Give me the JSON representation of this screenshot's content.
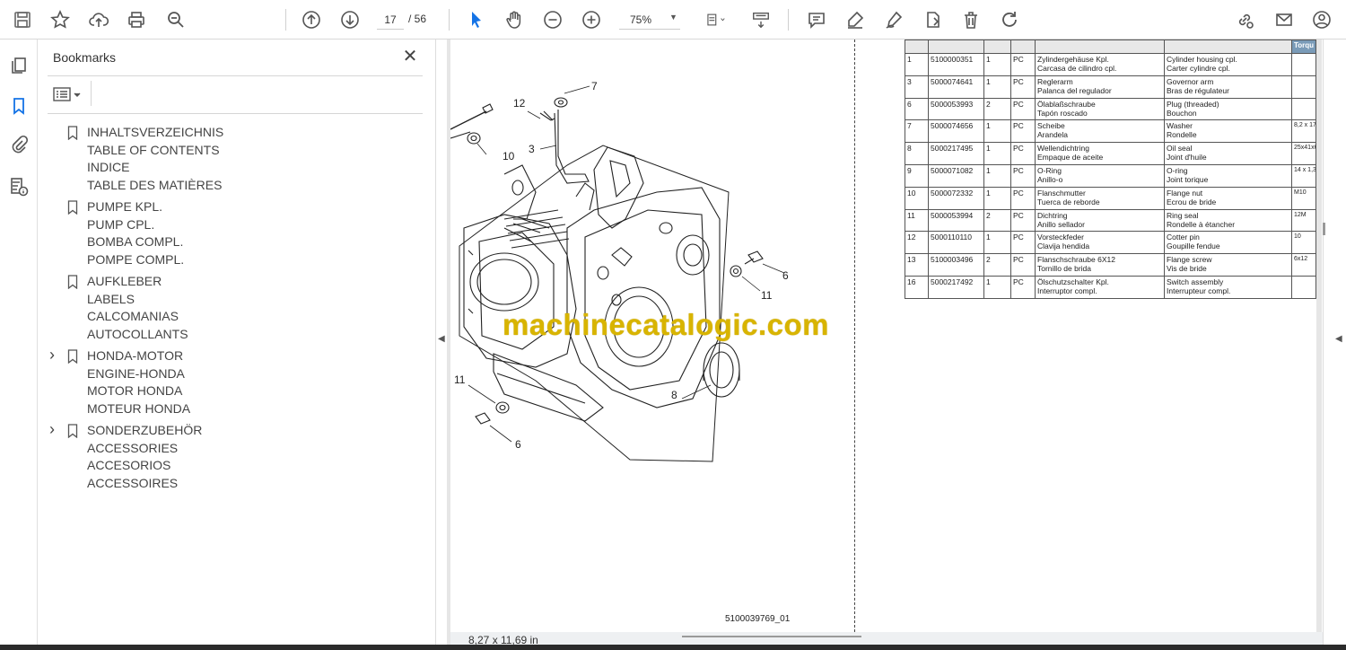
{
  "toolbar": {
    "page_current": "17",
    "page_total": "/ 56",
    "zoom": "75%",
    "icons": [
      "save-icon",
      "star-icon",
      "upload-icon",
      "print-icon",
      "search-zoom-icon",
      "page-up-icon",
      "page-down-icon",
      "zoom-out-icon",
      "zoom-in-icon",
      "select-cursor-icon",
      "hand-icon",
      "fit-page-icon",
      "scroll-mode-icon",
      "comment-icon",
      "highlight-icon",
      "draw-icon",
      "edit-text-icon",
      "delete-icon",
      "rotate-icon",
      "share-link-icon",
      "mail-icon",
      "account-icon"
    ]
  },
  "rail": {
    "icons": [
      "pages-icon",
      "bookmarks-icon",
      "attachments-icon",
      "file-info-icon"
    ]
  },
  "bookmarks": {
    "title": "Bookmarks",
    "entries": [
      {
        "expandable": false,
        "lines": [
          "INHALTSVERZEICHNIS",
          "TABLE OF CONTENTS",
          "INDICE",
          "TABLE DES MATIÈRES"
        ]
      },
      {
        "expandable": false,
        "lines": [
          "PUMPE KPL.",
          "PUMP CPL.",
          "BOMBA COMPL.",
          "POMPE COMPL."
        ]
      },
      {
        "expandable": false,
        "lines": [
          "AUFKLEBER",
          "LABELS",
          "CALCOMANIAS",
          "AUTOCOLLANTS"
        ]
      },
      {
        "expandable": true,
        "lines": [
          "HONDA-MOTOR",
          "ENGINE-HONDA",
          "MOTOR HONDA",
          "MOTEUR HONDA"
        ]
      },
      {
        "expandable": true,
        "lines": [
          "SONDERZUBEHÖR",
          "ACCESSORIES",
          "ACCESORIOS",
          "ACCESSOIRES"
        ]
      }
    ]
  },
  "document": {
    "callouts": [
      "7",
      "12",
      "3",
      "10",
      "6",
      "11",
      "11",
      "8",
      "6"
    ],
    "drawing_code": "5100039769_01",
    "watermark": "machinecatalogic.com",
    "table_header_torque": "Torqu",
    "parts": [
      {
        "pos": "1",
        "number": "5100000351",
        "qty": "1",
        "unit": "PC",
        "de": "Zylindergehäuse Kpl.",
        "es": "Carcasa de cilindro cpl.",
        "en": "Cylinder housing cpl.",
        "fr": "Carter cylindre cpl.",
        "spec": ""
      },
      {
        "pos": "3",
        "number": "5000074641",
        "qty": "1",
        "unit": "PC",
        "de": "Reglerarm",
        "es": "Palanca del regulador",
        "en": "Governor arm",
        "fr": "Bras de régulateur",
        "spec": ""
      },
      {
        "pos": "6",
        "number": "5000053993",
        "qty": "2",
        "unit": "PC",
        "de": "Ölablaßschraube",
        "es": "Tapón roscado",
        "en": "Plug (threaded)",
        "fr": "Bouchon",
        "spec": ""
      },
      {
        "pos": "7",
        "number": "5000074656",
        "qty": "1",
        "unit": "PC",
        "de": "Scheibe",
        "es": "Arandela",
        "en": "Washer",
        "fr": "Rondelle",
        "spec": "8,2 x 17"
      },
      {
        "pos": "8",
        "number": "5000217495",
        "qty": "1",
        "unit": "PC",
        "de": "Wellendichtring",
        "es": "Empaque de aceite",
        "en": "Oil seal",
        "fr": "Joint d'huile",
        "spec": "25x41x6"
      },
      {
        "pos": "9",
        "number": "5000071082",
        "qty": "1",
        "unit": "PC",
        "de": "O-Ring",
        "es": "Anillo-o",
        "en": "O-ring",
        "fr": "Joint torique",
        "spec": "14 x 1,3"
      },
      {
        "pos": "10",
        "number": "5000072332",
        "qty": "1",
        "unit": "PC",
        "de": "Flanschmutter",
        "es": "Tuerca de reborde",
        "en": "Flange nut",
        "fr": "Ecrou de bride",
        "spec": "M10"
      },
      {
        "pos": "11",
        "number": "5000053994",
        "qty": "2",
        "unit": "PC",
        "de": "Dichtring",
        "es": "Anillo sellador",
        "en": "Ring seal",
        "fr": "Rondelle à étancher",
        "spec": "12M"
      },
      {
        "pos": "12",
        "number": "5000110110",
        "qty": "1",
        "unit": "PC",
        "de": "Vorsteckfeder",
        "es": "Clavija hendida",
        "en": "Cotter pin",
        "fr": "Goupille fendue",
        "spec": "10"
      },
      {
        "pos": "13",
        "number": "5100003496",
        "qty": "2",
        "unit": "PC",
        "de": "Flanschschraube 6X12",
        "es": "Tornillo de brida",
        "en": "Flange screw",
        "fr": "Vis de bride",
        "spec": "6x12"
      },
      {
        "pos": "16",
        "number": "5000217492",
        "qty": "1",
        "unit": "PC",
        "de": "Ölschutzschalter Kpl.",
        "es": "Interruptor compl.",
        "en": "Switch assembly",
        "fr": "Interrupteur compl.",
        "spec": ""
      }
    ]
  },
  "status": {
    "page_size": "8,27 x 11,69 in"
  }
}
